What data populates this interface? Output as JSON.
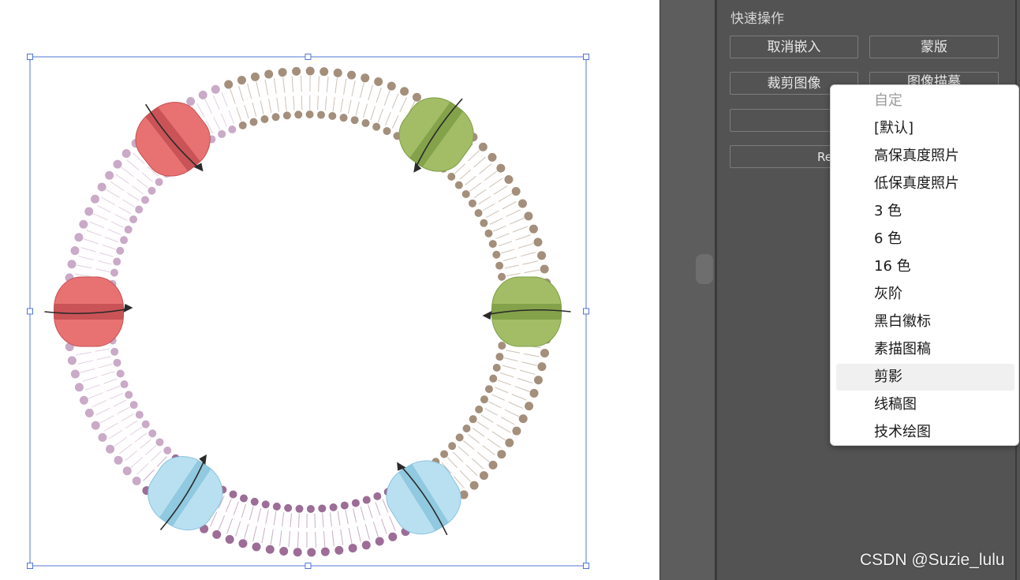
{
  "colors": {
    "panel_bg": "#535353",
    "protein_red": "#e87272",
    "protein_green": "#a2bd66",
    "protein_blue": "#b9e0f1",
    "lipid_pink": "#c9aac7",
    "lipid_tan": "#a38f7b",
    "lipid_purple": "#9c6d96",
    "selection": "#4f74d6"
  },
  "panel": {
    "title": "快速操作",
    "buttons": {
      "unembed": "取消嵌入",
      "mask": "蒙版",
      "crop": "裁剪图像",
      "trace": "图像描摹",
      "empty": "",
      "re": "Re"
    }
  },
  "dropdown": {
    "items": [
      {
        "label": "自定",
        "disabled": true
      },
      {
        "label": "[默认]"
      },
      {
        "label": "高保真度照片"
      },
      {
        "label": "低保真度照片"
      },
      {
        "label": "3 色"
      },
      {
        "label": "6 色"
      },
      {
        "label": "16 色"
      },
      {
        "label": "灰阶"
      },
      {
        "label": "黑白徽标"
      },
      {
        "label": "素描图稿"
      },
      {
        "label": "剪影",
        "highlighted": true
      },
      {
        "label": "线稿图"
      },
      {
        "label": "技术绘图"
      }
    ]
  },
  "watermark": "CSDN @Suzie_lulu"
}
